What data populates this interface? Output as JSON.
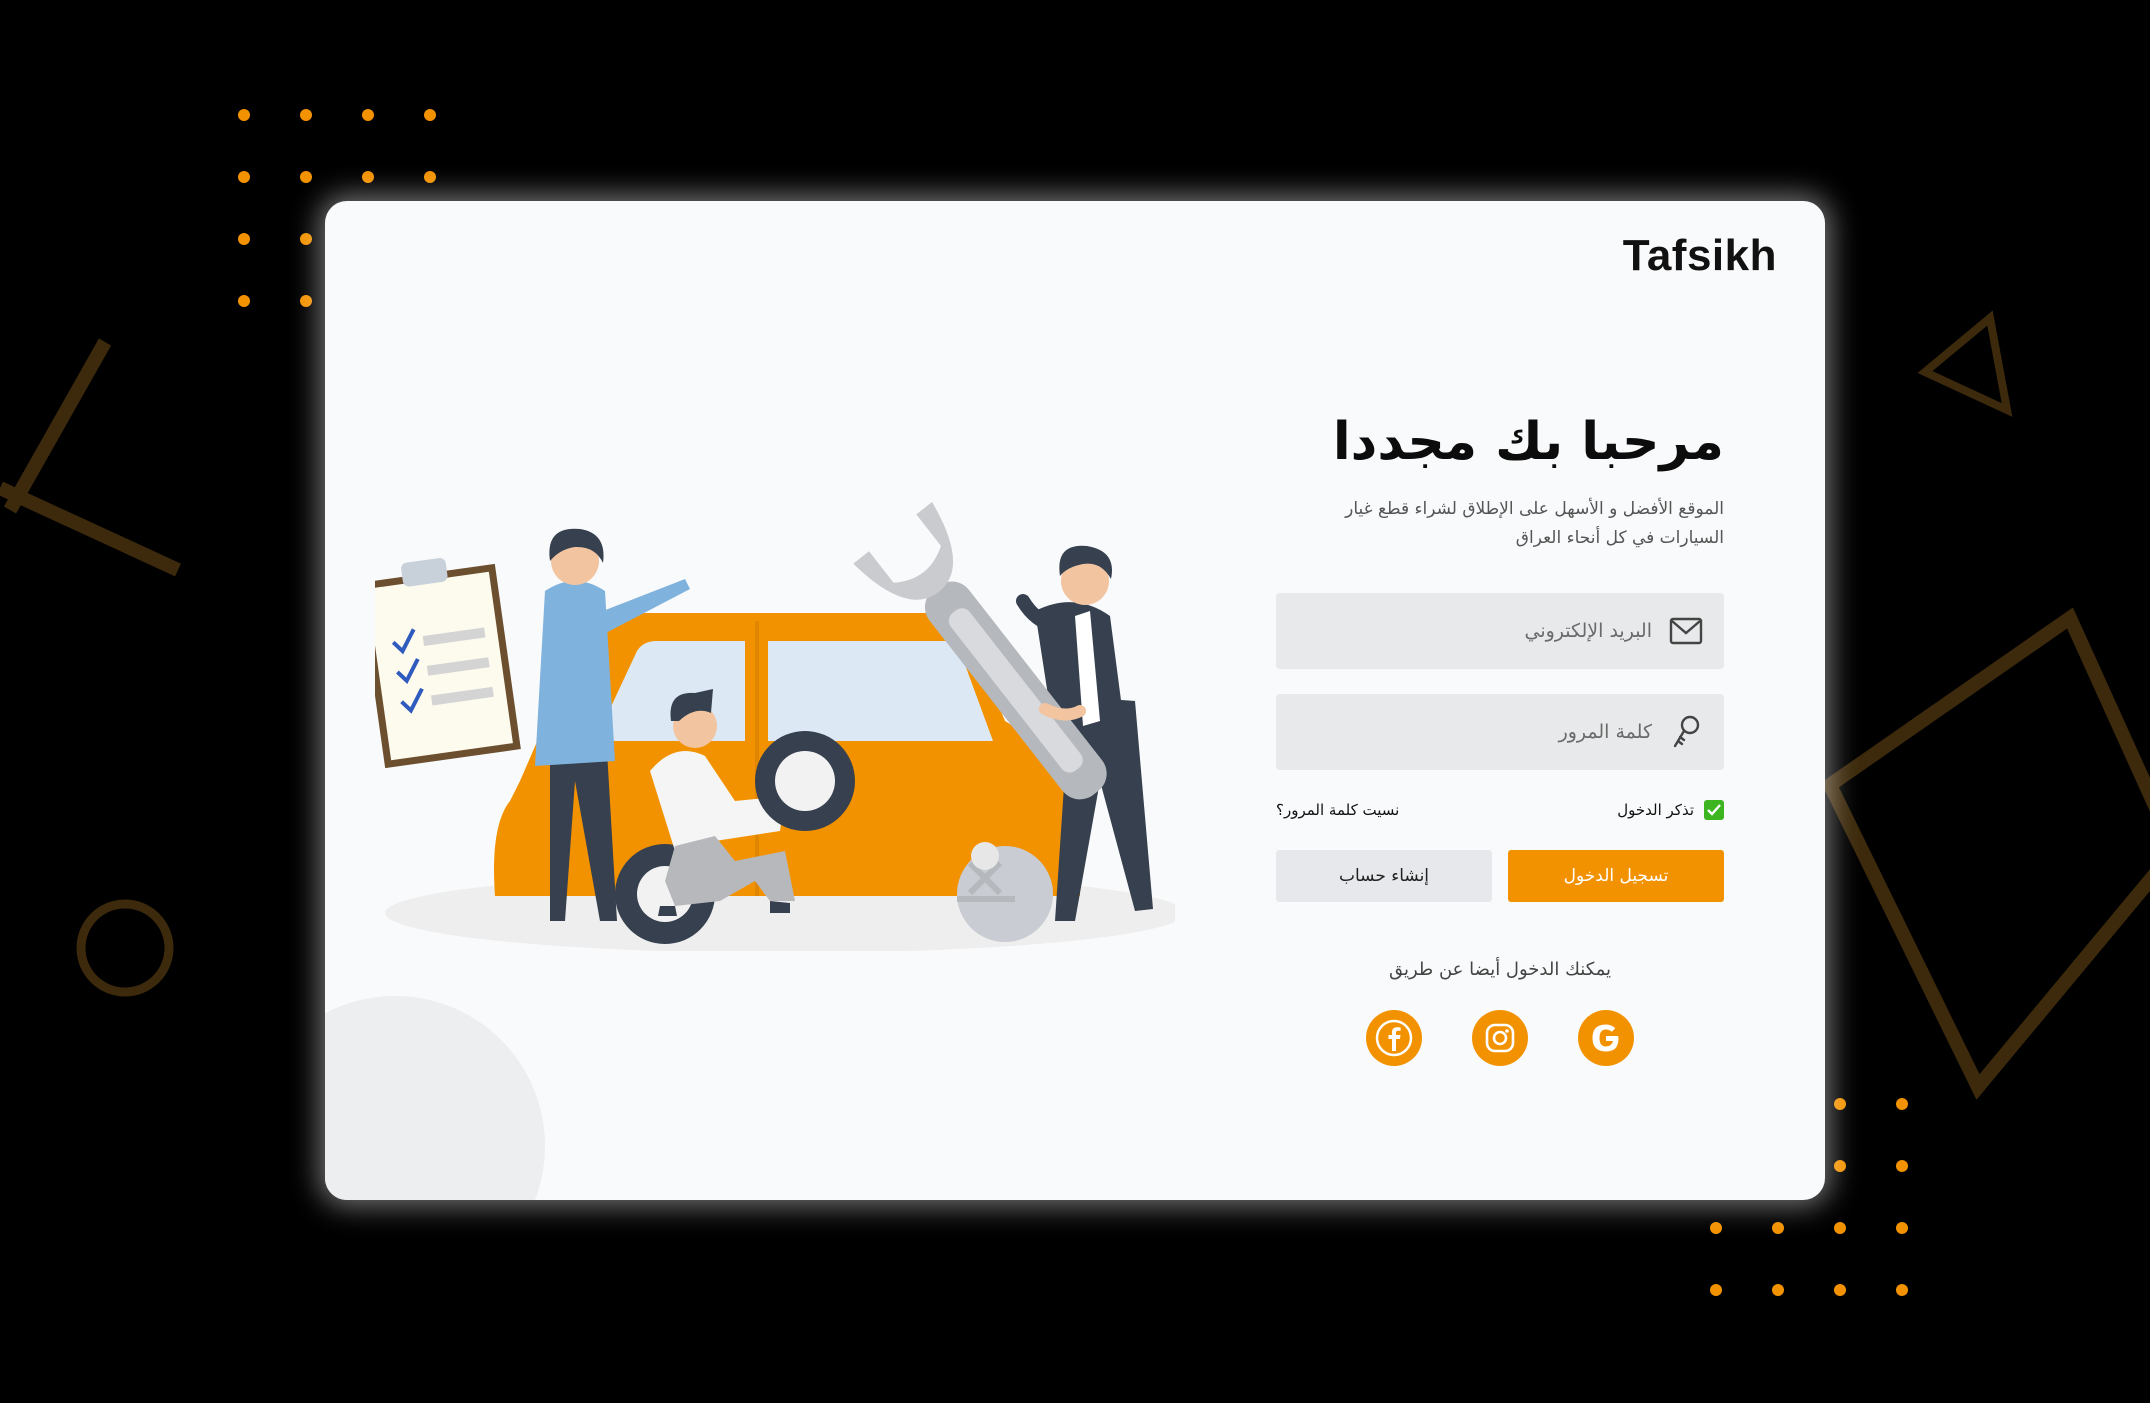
{
  "brand": {
    "name": "Tafsikh"
  },
  "login": {
    "title": "مرحبا بك مجددا",
    "subtitle": "الموقع الأفضل و الأسهل على الإطلاق لشراء قطع غيار السيارات في كل أنحاء العراق",
    "email_placeholder": "البريد الإلكتروني",
    "password_placeholder": "كلمة المرور",
    "remember_label": "تذكر الدخول",
    "remember_checked": true,
    "forgot_label": "نسيت كلمة المرور؟",
    "login_button": "تسجيل الدخول",
    "signup_button": "إنشاء حساب",
    "social_caption": "يمكنك الدخول أيضا عن طريق",
    "social": [
      "google-icon",
      "instagram-icon",
      "facebook-icon"
    ]
  },
  "colors": {
    "accent": "#f39200",
    "background": "#000000",
    "card": "#f9fafb",
    "check": "#3cb521",
    "illustration_dark": "#36404f"
  }
}
